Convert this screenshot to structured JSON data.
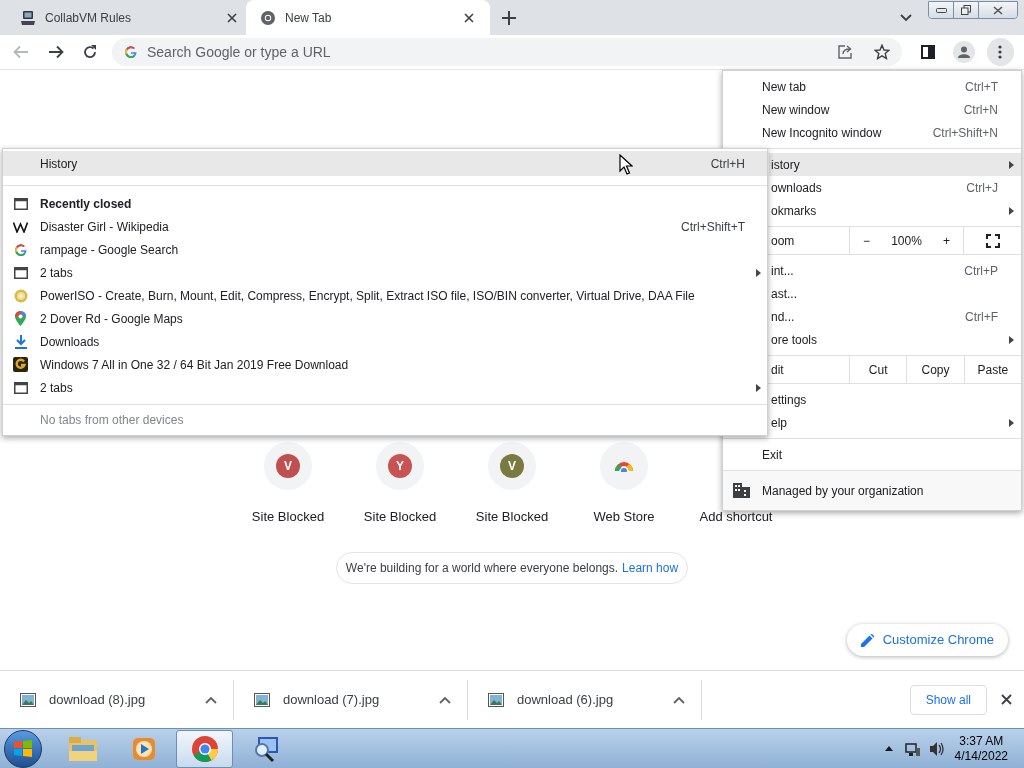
{
  "tabs": [
    {
      "label": "CollabVM Rules",
      "selected": false
    },
    {
      "label": "New Tab",
      "selected": true
    }
  ],
  "omnibox": {
    "placeholder": "Search Google or type a URL"
  },
  "shortcuts": [
    {
      "label": "Site Blocked",
      "kind": "letter",
      "letter": "V",
      "color": "#c0504f"
    },
    {
      "label": "Site Blocked",
      "kind": "letter",
      "letter": "Y",
      "color": "#c95252"
    },
    {
      "label": "Site Blocked",
      "kind": "letter",
      "letter": "V",
      "color": "#7b7a3e"
    },
    {
      "label": "Web Store",
      "kind": "webstore"
    },
    {
      "label": "Add shortcut",
      "kind": "add"
    }
  ],
  "notice": {
    "text": "We're building for a world where everyone belongs.",
    "link": "Learn how"
  },
  "customize_button": "Customize Chrome",
  "main_menu": {
    "sections": [
      {
        "kind": "items",
        "items": [
          {
            "label": "New tab",
            "shortcut": "Ctrl+T",
            "has_submenu": false,
            "highlighted": false
          },
          {
            "label": "New window",
            "shortcut": "Ctrl+N",
            "has_submenu": false,
            "highlighted": false
          },
          {
            "label": "New Incognito window",
            "shortcut": "Ctrl+Shift+N",
            "has_submenu": false,
            "highlighted": false
          }
        ]
      },
      {
        "kind": "items",
        "items": [
          {
            "label": "istory",
            "has_submenu": true,
            "highlighted": true
          },
          {
            "label": "ownloads",
            "shortcut": "Ctrl+J",
            "has_submenu": false,
            "highlighted": false
          },
          {
            "label": "okmarks",
            "has_submenu": true,
            "highlighted": false
          }
        ]
      },
      {
        "kind": "zoom",
        "label": "oom",
        "buttons": [
          "−",
          "100%",
          "+"
        ]
      },
      {
        "kind": "items",
        "items": [
          {
            "label": "int...",
            "shortcut": "Ctrl+P",
            "has_submenu": false,
            "highlighted": false
          },
          {
            "label": "ast...",
            "has_submenu": false,
            "highlighted": false
          },
          {
            "label": "nd...",
            "shortcut": "Ctrl+F",
            "has_submenu": false,
            "highlighted": false
          },
          {
            "label": "ore tools",
            "has_submenu": true,
            "highlighted": false
          }
        ]
      },
      {
        "kind": "edit",
        "label": "dit",
        "buttons": [
          "Cut",
          "Copy",
          "Paste"
        ]
      },
      {
        "kind": "items",
        "items": [
          {
            "label": "ettings",
            "has_submenu": false,
            "highlighted": false
          },
          {
            "label": "elp",
            "has_submenu": true,
            "highlighted": false
          }
        ]
      },
      {
        "kind": "items",
        "items": [
          {
            "label": "Exit",
            "has_submenu": false,
            "highlighted": false
          }
        ]
      },
      {
        "kind": "managed",
        "label": "Managed by your organization"
      }
    ]
  },
  "history_submenu": {
    "title": {
      "label": "History",
      "shortcut": "Ctrl+H",
      "highlighted": true
    },
    "items": [
      {
        "kind": "header",
        "label": "Recently closed"
      },
      {
        "kind": "page",
        "label": "Disaster Girl - Wikipedia",
        "shortcut": "Ctrl+Shift+T"
      },
      {
        "kind": "page",
        "label": "rampage - Google Search"
      },
      {
        "kind": "group",
        "label": "2 tabs"
      },
      {
        "kind": "page",
        "label": "PowerISO - Create, Burn, Mount, Edit, Compress, Encrypt, Split, Extract ISO file, ISO/BIN converter, Virtual Drive, DAA File"
      },
      {
        "kind": "page",
        "label": "2 Dover Rd - Google Maps"
      },
      {
        "kind": "page",
        "label": "Downloads"
      },
      {
        "kind": "page",
        "label": "Windows 7 All in One 32 / 64 Bit Jan 2019 Free Download"
      },
      {
        "kind": "group",
        "label": "2 tabs"
      }
    ],
    "footer": "No tabs from other devices"
  },
  "downloads": [
    {
      "name": "download (8).jpg"
    },
    {
      "name": "download (7).jpg"
    },
    {
      "name": "download (6).jpg"
    }
  ],
  "downloads_show_all": "Show all",
  "taskbar": {
    "apps": [
      {
        "active": false
      },
      {
        "active": false
      },
      {
        "active": true
      },
      {
        "active": false
      }
    ],
    "time": "3:37 AM",
    "date": "4/14/2022"
  }
}
